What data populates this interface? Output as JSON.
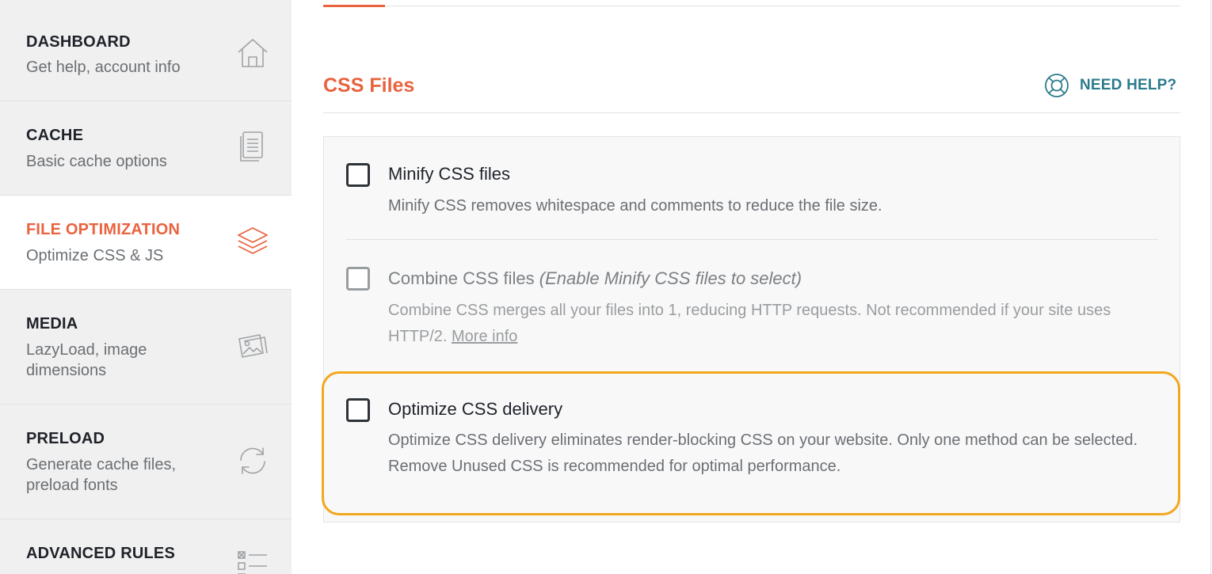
{
  "sidebar": {
    "items": [
      {
        "title": "DASHBOARD",
        "desc": "Get help, account info",
        "icon": "home-icon"
      },
      {
        "title": "CACHE",
        "desc": "Basic cache options",
        "icon": "document-icon"
      },
      {
        "title": "FILE OPTIMIZATION",
        "desc": "Optimize CSS & JS",
        "icon": "layers-icon",
        "active": true
      },
      {
        "title": "MEDIA",
        "desc": "LazyLoad, image dimensions",
        "icon": "images-icon"
      },
      {
        "title": "PRELOAD",
        "desc": "Generate cache files, preload fonts",
        "icon": "refresh-icon"
      },
      {
        "title": "ADVANCED RULES",
        "desc": "",
        "icon": "checklist-icon"
      }
    ]
  },
  "section": {
    "title": "CSS Files",
    "help_label": "NEED HELP?"
  },
  "options": {
    "minify": {
      "label": "Minify CSS files",
      "desc": "Minify CSS removes whitespace and comments to reduce the file size.",
      "checked": false
    },
    "combine": {
      "label": "Combine CSS files",
      "label_note": "(Enable Minify CSS files to select)",
      "desc": "Combine CSS merges all your files into 1, reducing HTTP requests. Not recommended if your site uses HTTP/2.",
      "link": "More info",
      "checked": false,
      "disabled": true
    },
    "optimize_delivery": {
      "label": "Optimize CSS delivery",
      "desc": "Optimize CSS delivery eliminates render-blocking CSS on your website. Only one method can be selected. Remove Unused CSS is recommended for optimal performance.",
      "checked": false
    }
  },
  "colors": {
    "accent": "#e9633f",
    "help": "#2b7b8c",
    "highlight": "#f2a81d"
  }
}
